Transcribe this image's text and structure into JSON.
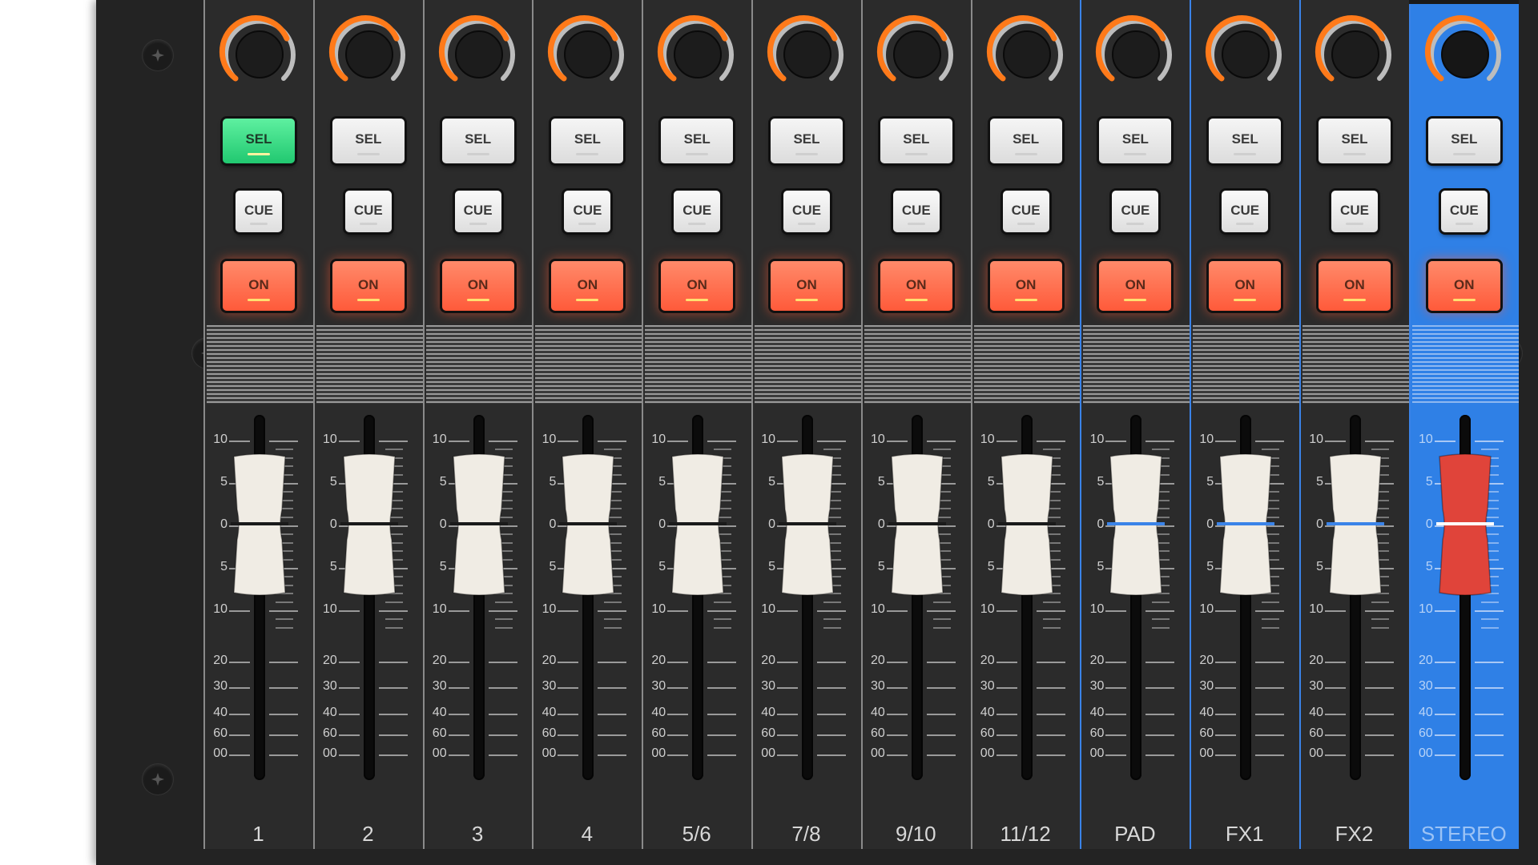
{
  "mixer": {
    "scale_labels": [
      "10",
      "5",
      "0",
      "5",
      "10",
      "20",
      "30",
      "40",
      "60",
      "00"
    ],
    "button_labels": {
      "sel": "SEL",
      "cue": "CUE",
      "on": "ON"
    },
    "colors": {
      "panel": "#232323",
      "knob_ring": "#ff7a1a",
      "sel_active": "#2fd67f",
      "on_button": "#ff6a4a",
      "bus_accent": "#3a83e8",
      "stereo_strip": "#2f80e6",
      "fader_cap": "#f0ece4",
      "stereo_fader_cap": "#e0443a"
    },
    "channels": [
      {
        "name": "1",
        "sel_active": true,
        "type": "input"
      },
      {
        "name": "2",
        "sel_active": false,
        "type": "input"
      },
      {
        "name": "3",
        "sel_active": false,
        "type": "input"
      },
      {
        "name": "4",
        "sel_active": false,
        "type": "input"
      },
      {
        "name": "5/6",
        "sel_active": false,
        "type": "input"
      },
      {
        "name": "7/8",
        "sel_active": false,
        "type": "input"
      },
      {
        "name": "9/10",
        "sel_active": false,
        "type": "input"
      },
      {
        "name": "11/12",
        "sel_active": false,
        "type": "input"
      },
      {
        "name": "PAD",
        "sel_active": false,
        "type": "bus"
      },
      {
        "name": "FX1",
        "sel_active": false,
        "type": "bus"
      },
      {
        "name": "FX2",
        "sel_active": false,
        "type": "bus"
      },
      {
        "name": "STEREO",
        "sel_active": false,
        "type": "master"
      }
    ]
  }
}
